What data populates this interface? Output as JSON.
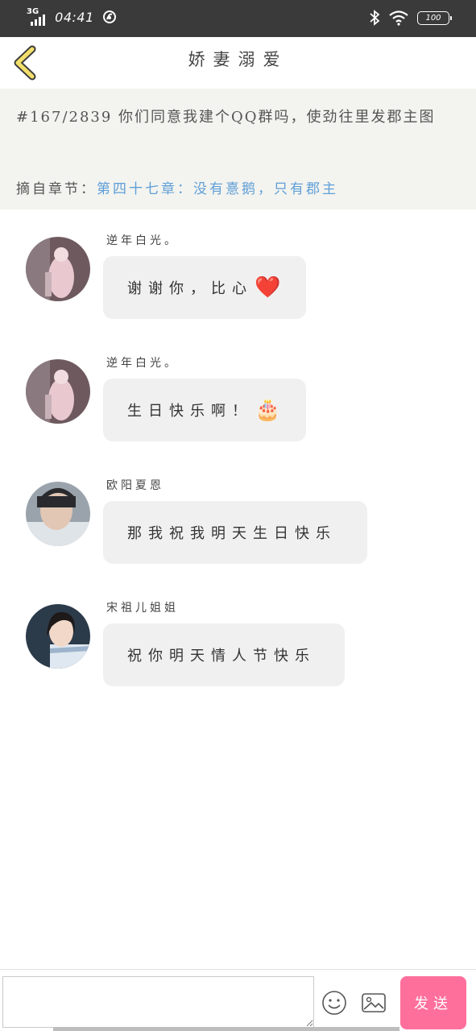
{
  "status_bar": {
    "network": "3G",
    "time": "04:41",
    "battery": "100",
    "icons": [
      "signal-icon",
      "nfc-icon",
      "bluetooth-icon",
      "wifi-icon",
      "battery-icon"
    ]
  },
  "nav": {
    "title": "娇妻溺爱",
    "back_icon": "chevron-left-icon"
  },
  "info": {
    "text": "#167/2839 你们同意我建个QQ群吗，使劲往里发郡主图",
    "chapter_label": "摘自章节：",
    "chapter_link": "第四十七章：没有憙鹅，只有郡主"
  },
  "messages": [
    {
      "sender": "逆年白光。",
      "text": "谢谢你，比心",
      "emoji": "❤️"
    },
    {
      "sender": "逆年白光。",
      "text": "生日快乐啊！",
      "emoji": "🎂"
    },
    {
      "sender": "欧阳夏恩",
      "text": "那我祝我明天生日快乐",
      "emoji": ""
    },
    {
      "sender": "宋祖儿姐姐",
      "text": "祝你明天情人节快乐",
      "emoji": ""
    }
  ],
  "input_bar": {
    "placeholder": "",
    "send_label": "发送"
  },
  "colors": {
    "status_bar": "#3a3a3a",
    "back_icon": "#f2df6b",
    "info_panel": "#f3f3ef",
    "chapter_link": "#5f9fd8",
    "bubble": "#f0f0f0",
    "send_button": "#ff6f9c"
  }
}
